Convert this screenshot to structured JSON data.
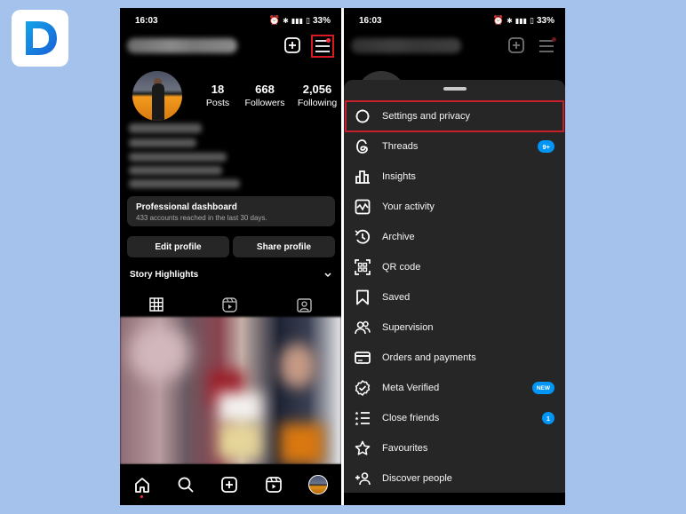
{
  "brand": {
    "logo_letter": "D",
    "logo_color": "#1a73e8"
  },
  "left_screen": {
    "status_bar": {
      "time": "16:03",
      "battery": "33%"
    },
    "profile": {
      "stats": [
        {
          "value": "18",
          "label": "Posts"
        },
        {
          "value": "668",
          "label": "Followers"
        },
        {
          "value": "2,056",
          "label": "Following"
        }
      ]
    },
    "professional_dashboard": {
      "title": "Professional dashboard",
      "subtitle": "433 accounts reached in the last 30 days."
    },
    "buttons": {
      "edit_profile": "Edit profile",
      "share_profile": "Share profile"
    },
    "story_highlights": "Story Highlights",
    "highlight_color": "#d71920"
  },
  "right_screen": {
    "status_bar": {
      "time": "16:03",
      "battery": "33%"
    },
    "menu_items": [
      {
        "label": "Settings and privacy",
        "icon": "gear-icon",
        "selected": true
      },
      {
        "label": "Threads",
        "icon": "threads-icon",
        "badge": "9+"
      },
      {
        "label": "Insights",
        "icon": "insights-icon"
      },
      {
        "label": "Your activity",
        "icon": "activity-icon"
      },
      {
        "label": "Archive",
        "icon": "archive-icon"
      },
      {
        "label": "QR code",
        "icon": "qr-code-icon"
      },
      {
        "label": "Saved",
        "icon": "bookmark-icon"
      },
      {
        "label": "Supervision",
        "icon": "supervision-icon"
      },
      {
        "label": "Orders and payments",
        "icon": "card-icon"
      },
      {
        "label": "Meta Verified",
        "icon": "verified-icon",
        "badge": "NEW"
      },
      {
        "label": "Close friends",
        "icon": "close-friends-icon",
        "badge": "1"
      },
      {
        "label": "Favourites",
        "icon": "star-icon"
      },
      {
        "label": "Discover people",
        "icon": "add-person-icon"
      }
    ],
    "badge_color": "#0095f6"
  }
}
